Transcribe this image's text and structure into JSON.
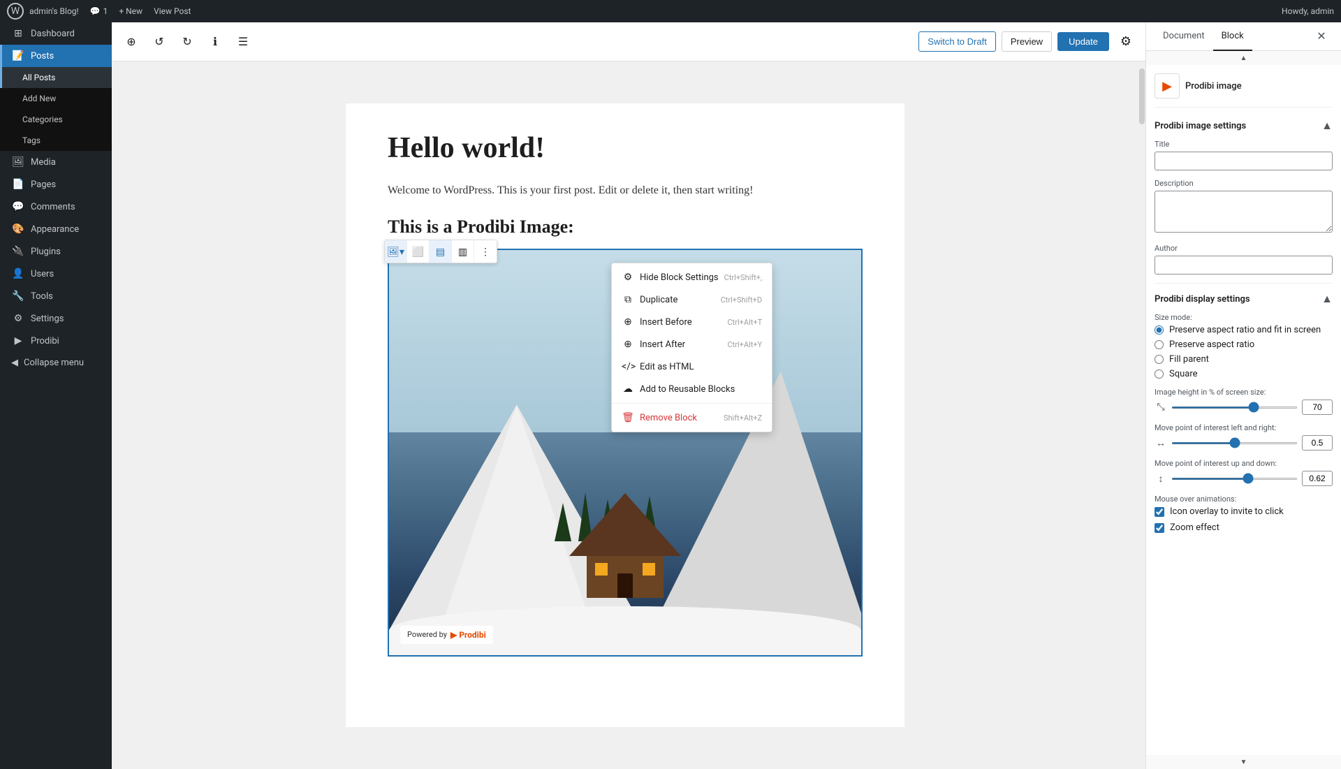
{
  "adminbar": {
    "logo": "W",
    "site_name": "admin's Blog!",
    "comments": "1",
    "new_label": "+ New",
    "view_post": "View Post",
    "howdy": "Howdy, admin"
  },
  "sidebar": {
    "items": [
      {
        "id": "dashboard",
        "icon": "⊞",
        "label": "Dashboard"
      },
      {
        "id": "posts",
        "icon": "📝",
        "label": "Posts",
        "active": true
      },
      {
        "id": "media",
        "icon": "🖼",
        "label": "Media"
      },
      {
        "id": "pages",
        "icon": "📄",
        "label": "Pages"
      },
      {
        "id": "comments",
        "icon": "💬",
        "label": "Comments"
      },
      {
        "id": "appearance",
        "icon": "🎨",
        "label": "Appearance"
      },
      {
        "id": "plugins",
        "icon": "🔌",
        "label": "Plugins"
      },
      {
        "id": "users",
        "icon": "👤",
        "label": "Users"
      },
      {
        "id": "tools",
        "icon": "🔧",
        "label": "Tools"
      },
      {
        "id": "settings",
        "icon": "⚙",
        "label": "Settings"
      },
      {
        "id": "prodibi",
        "icon": "▶",
        "label": "Prodibi"
      }
    ],
    "submenu": {
      "posts": [
        {
          "label": "All Posts",
          "active": true
        },
        {
          "label": "Add New"
        },
        {
          "label": "Categories"
        },
        {
          "label": "Tags"
        }
      ]
    },
    "collapse": "Collapse menu"
  },
  "toolbar": {
    "add_block": "⊕",
    "undo": "↺",
    "redo": "↻",
    "info": "ℹ",
    "list_view": "☰",
    "switch_draft_label": "Switch to Draft",
    "preview_label": "Preview",
    "update_label": "Update",
    "settings_label": "⚙"
  },
  "post": {
    "title": "Hello world!",
    "body": "Welcome to WordPress. This is your first post. Edit or delete it, then start writing!",
    "block_heading": "This is a Prodibi Image:"
  },
  "block_toolbar": {
    "buttons": [
      {
        "id": "image-type",
        "icon": "🖼",
        "active": true
      },
      {
        "id": "align-left",
        "icon": "≡"
      },
      {
        "id": "align-center",
        "icon": "≡"
      },
      {
        "id": "align-right",
        "icon": "≡"
      },
      {
        "id": "more",
        "icon": "⋮"
      }
    ]
  },
  "context_menu": {
    "items": [
      {
        "id": "hide-block-settings",
        "icon": "⚙",
        "label": "Hide Block Settings",
        "shortcut": "Ctrl+Shift+,"
      },
      {
        "id": "duplicate",
        "icon": "⧉",
        "label": "Duplicate",
        "shortcut": "Ctrl+Shift+D"
      },
      {
        "id": "insert-before",
        "icon": "⊕",
        "label": "Insert Before",
        "shortcut": "Ctrl+Alt+T"
      },
      {
        "id": "insert-after",
        "icon": "⊕",
        "label": "Insert After",
        "shortcut": "Ctrl+Alt+Y"
      },
      {
        "id": "edit-as-html",
        "icon": "⟨⟩",
        "label": "Edit as HTML",
        "shortcut": ""
      },
      {
        "id": "add-reusable",
        "icon": "☁",
        "label": "Add to Reusable Blocks",
        "shortcut": ""
      },
      {
        "id": "remove-block",
        "icon": "🗑",
        "label": "Remove Block",
        "shortcut": "Shift+Alt+Z",
        "destructive": true
      }
    ]
  },
  "image": {
    "powered_by": "Powered by",
    "brand": "Prodibi"
  },
  "right_panel": {
    "tabs": [
      "Document",
      "Block"
    ],
    "active_tab": "Block",
    "block_name": "Prodibi image",
    "sections": {
      "image_settings": {
        "title": "Prodibi image settings",
        "fields": {
          "title_label": "Title",
          "title_value": "",
          "description_label": "Description",
          "description_value": "",
          "author_label": "Author",
          "author_value": ""
        }
      },
      "display_settings": {
        "title": "Prodibi display settings",
        "size_mode_label": "Size mode:",
        "size_options": [
          {
            "id": "preserve-fit",
            "label": "Preserve aspect ratio and fit in screen",
            "checked": true
          },
          {
            "id": "preserve-ratio",
            "label": "Preserve aspect ratio",
            "checked": false
          },
          {
            "id": "fill-parent",
            "label": "Fill parent",
            "checked": false
          },
          {
            "id": "square",
            "label": "Square",
            "checked": false
          }
        ],
        "height_label": "Image height in % of screen size:",
        "height_value": "70",
        "height_min": 10,
        "height_max": 100,
        "height_slider_val": 70,
        "left_right_label": "Move point of interest left and right:",
        "left_right_value": "0.5",
        "left_right_slider_val": 50,
        "up_down_label": "Move point of interest up and down:",
        "up_down_value": "0.62",
        "up_down_slider_val": 62,
        "mouse_over_label": "Mouse over animations:",
        "checkboxes": [
          {
            "id": "icon-overlay",
            "label": "Icon overlay to invite to click",
            "checked": true
          },
          {
            "id": "zoom-effect",
            "label": "Zoom effect",
            "checked": true
          }
        ]
      }
    }
  }
}
